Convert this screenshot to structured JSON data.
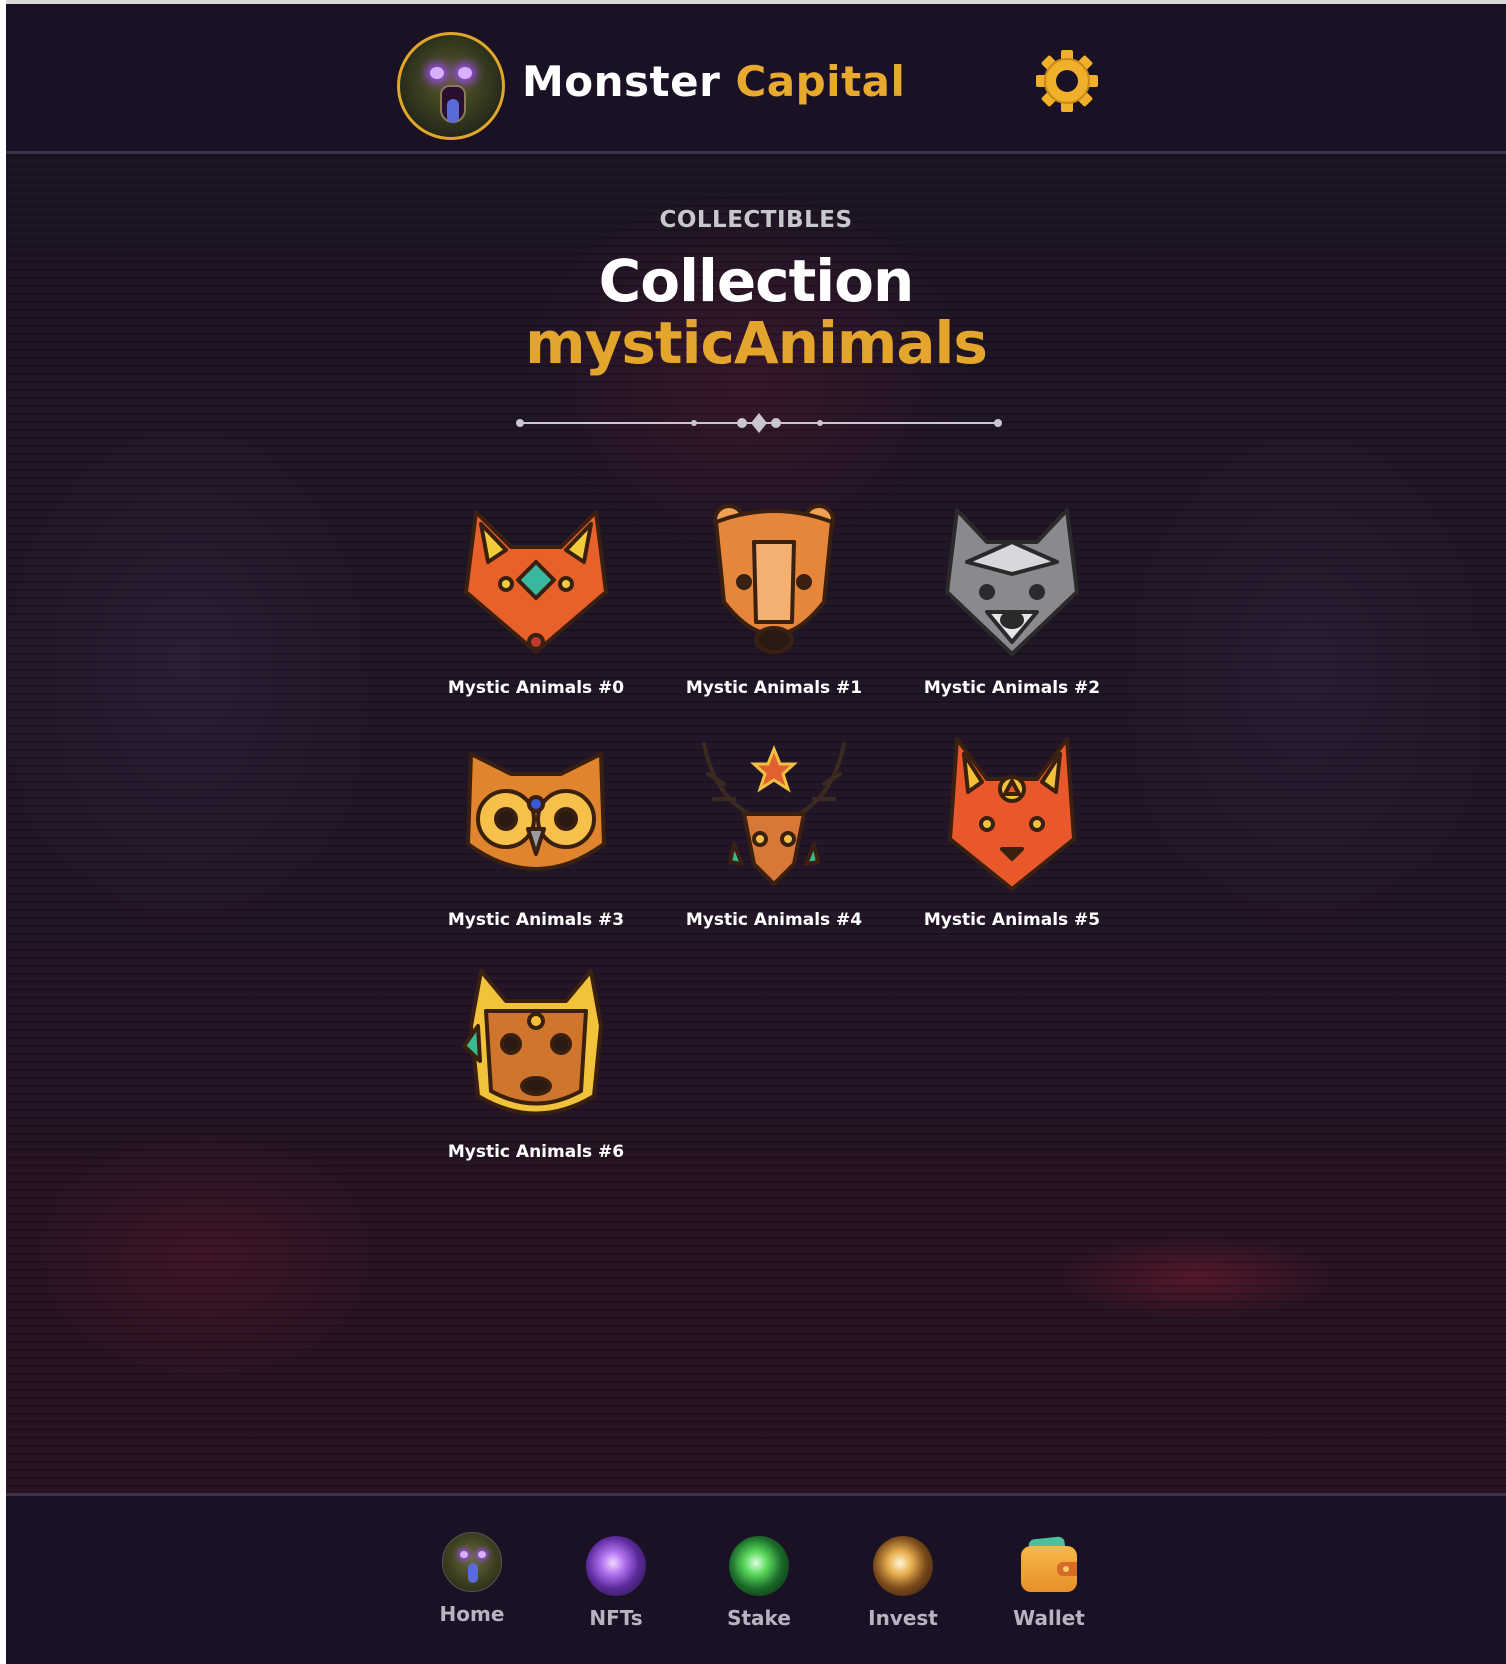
{
  "header": {
    "brand_primary": "Monster",
    "brand_secondary": "Capital",
    "settings_icon": "gear-icon",
    "accent_color": "#e8aa2e"
  },
  "page": {
    "eyebrow": "COLLECTIBLES",
    "title_line1": "Collection",
    "title_line2": "mysticAnimals"
  },
  "collection": {
    "items": [
      {
        "name": "Mystic Animals #0",
        "icon": "fox-icon"
      },
      {
        "name": "Mystic Animals #1",
        "icon": "bear-icon"
      },
      {
        "name": "Mystic Animals #2",
        "icon": "wolf-icon"
      },
      {
        "name": "Mystic Animals #3",
        "icon": "owl-icon"
      },
      {
        "name": "Mystic Animals #4",
        "icon": "deer-icon"
      },
      {
        "name": "Mystic Animals #5",
        "icon": "lynx-icon"
      },
      {
        "name": "Mystic Animals #6",
        "icon": "squirrel-icon"
      }
    ]
  },
  "nav": {
    "items": [
      {
        "label": "Home",
        "icon": "monster-home-icon"
      },
      {
        "label": "NFTs",
        "icon": "purple-orb-icon"
      },
      {
        "label": "Stake",
        "icon": "green-orb-icon"
      },
      {
        "label": "Invest",
        "icon": "gold-orb-icon"
      },
      {
        "label": "Wallet",
        "icon": "wallet-icon"
      }
    ]
  }
}
